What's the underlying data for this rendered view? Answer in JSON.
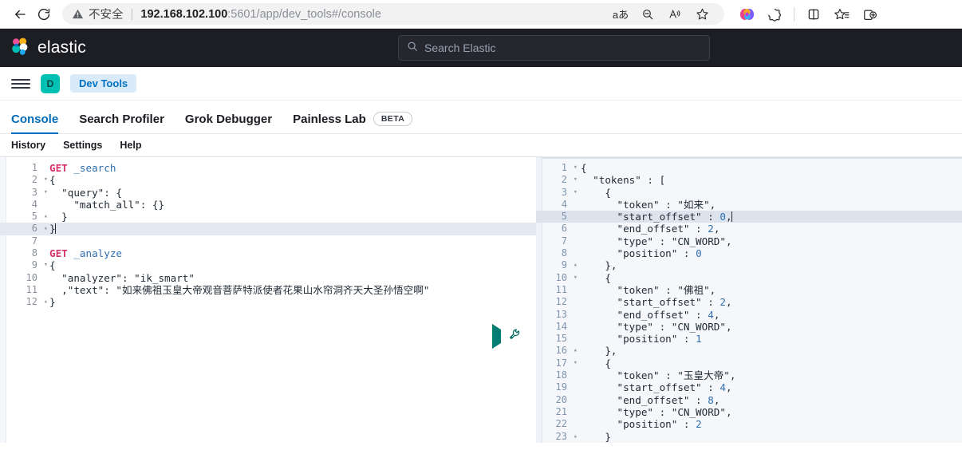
{
  "browser": {
    "back_label": "←",
    "reload_label": "⟳",
    "security_text": "不安全",
    "url_host": "192.168.102.100",
    "url_path": ":5601/app/dev_tools#/console",
    "omnibox_icons": [
      {
        "name": "translate-icon",
        "glyph": "aあ"
      },
      {
        "name": "zoom-out-icon",
        "glyph": "⊖"
      },
      {
        "name": "read-aloud-icon",
        "glyph": "A"
      },
      {
        "name": "favorite-star-icon",
        "glyph": "☆"
      }
    ],
    "toolbar_icons": [
      {
        "name": "copilot-icon",
        "glyph": "◕"
      },
      {
        "name": "browser-essentials-icon",
        "glyph": "❖"
      },
      {
        "name": "split-screen-icon",
        "glyph": "◫"
      },
      {
        "name": "favorites-list-icon",
        "glyph": "☆"
      },
      {
        "name": "collections-icon",
        "glyph": "⊞"
      }
    ]
  },
  "elastic_header": {
    "brand": "elastic",
    "search_placeholder": "Search Elastic"
  },
  "app_nav": {
    "menu_label": "menu",
    "space_initial": "D",
    "breadcrumb": "Dev Tools"
  },
  "tabs": [
    {
      "label": "Console",
      "active": true,
      "badge": null
    },
    {
      "label": "Search Profiler",
      "active": false,
      "badge": null
    },
    {
      "label": "Grok Debugger",
      "active": false,
      "badge": null
    },
    {
      "label": "Painless Lab",
      "active": false,
      "badge": "BETA"
    }
  ],
  "console_tools": [
    {
      "label": "History"
    },
    {
      "label": "Settings"
    },
    {
      "label": "Help"
    }
  ],
  "request_editor": {
    "active_line": 6,
    "lines": [
      {
        "n": 1,
        "fold": "",
        "text": "GET _search"
      },
      {
        "n": 2,
        "fold": "▾",
        "text": "{"
      },
      {
        "n": 3,
        "fold": "▾",
        "text": "  \"query\": {"
      },
      {
        "n": 4,
        "fold": "",
        "text": "    \"match_all\": {}"
      },
      {
        "n": 5,
        "fold": "▴",
        "text": "  }"
      },
      {
        "n": 6,
        "fold": "▴",
        "text": "}"
      },
      {
        "n": 7,
        "fold": "",
        "text": ""
      },
      {
        "n": 8,
        "fold": "",
        "text": "GET _analyze"
      },
      {
        "n": 9,
        "fold": "▾",
        "text": "{"
      },
      {
        "n": 10,
        "fold": "",
        "text": "  \"analyzer\": \"ik_smart\""
      },
      {
        "n": 11,
        "fold": "",
        "text": "  ,\"text\": \"如来佛祖玉皇大帝观音菩萨特派使者花果山水帘洞齐天大圣孙悟空啊\""
      },
      {
        "n": 12,
        "fold": "▴",
        "text": "}"
      }
    ],
    "actions": [
      {
        "name": "run-request-button",
        "label": "play"
      },
      {
        "name": "wrench-menu-button",
        "label": "wrench"
      }
    ]
  },
  "response_editor": {
    "active_line": 5,
    "lines": [
      {
        "n": 1,
        "fold": "▾",
        "text": "{"
      },
      {
        "n": 2,
        "fold": "▾",
        "text": "  \"tokens\" : ["
      },
      {
        "n": 3,
        "fold": "▾",
        "text": "    {"
      },
      {
        "n": 4,
        "fold": "",
        "text": "      \"token\" : \"如来\","
      },
      {
        "n": 5,
        "fold": "",
        "text": "      \"start_offset\" : 0,"
      },
      {
        "n": 6,
        "fold": "",
        "text": "      \"end_offset\" : 2,"
      },
      {
        "n": 7,
        "fold": "",
        "text": "      \"type\" : \"CN_WORD\","
      },
      {
        "n": 8,
        "fold": "",
        "text": "      \"position\" : 0"
      },
      {
        "n": 9,
        "fold": "▴",
        "text": "    },"
      },
      {
        "n": 10,
        "fold": "▾",
        "text": "    {"
      },
      {
        "n": 11,
        "fold": "",
        "text": "      \"token\" : \"佛祖\","
      },
      {
        "n": 12,
        "fold": "",
        "text": "      \"start_offset\" : 2,"
      },
      {
        "n": 13,
        "fold": "",
        "text": "      \"end_offset\" : 4,"
      },
      {
        "n": 14,
        "fold": "",
        "text": "      \"type\" : \"CN_WORD\","
      },
      {
        "n": 15,
        "fold": "",
        "text": "      \"position\" : 1"
      },
      {
        "n": 16,
        "fold": "▴",
        "text": "    },"
      },
      {
        "n": 17,
        "fold": "▾",
        "text": "    {"
      },
      {
        "n": 18,
        "fold": "",
        "text": "      \"token\" : \"玉皇大帝\","
      },
      {
        "n": 19,
        "fold": "",
        "text": "      \"start_offset\" : 4,"
      },
      {
        "n": 20,
        "fold": "",
        "text": "      \"end_offset\" : 8,"
      },
      {
        "n": 21,
        "fold": "",
        "text": "      \"type\" : \"CN_WORD\","
      },
      {
        "n": 22,
        "fold": "",
        "text": "      \"position\" : 2"
      },
      {
        "n": 23,
        "fold": "▴",
        "text": "    }"
      }
    ]
  },
  "colors": {
    "elastic_dark": "#1d1e24",
    "accent_blue": "#0071c2",
    "teal": "#00bfb3",
    "string_green": "#3f9142",
    "method_pink": "#d6336c"
  }
}
